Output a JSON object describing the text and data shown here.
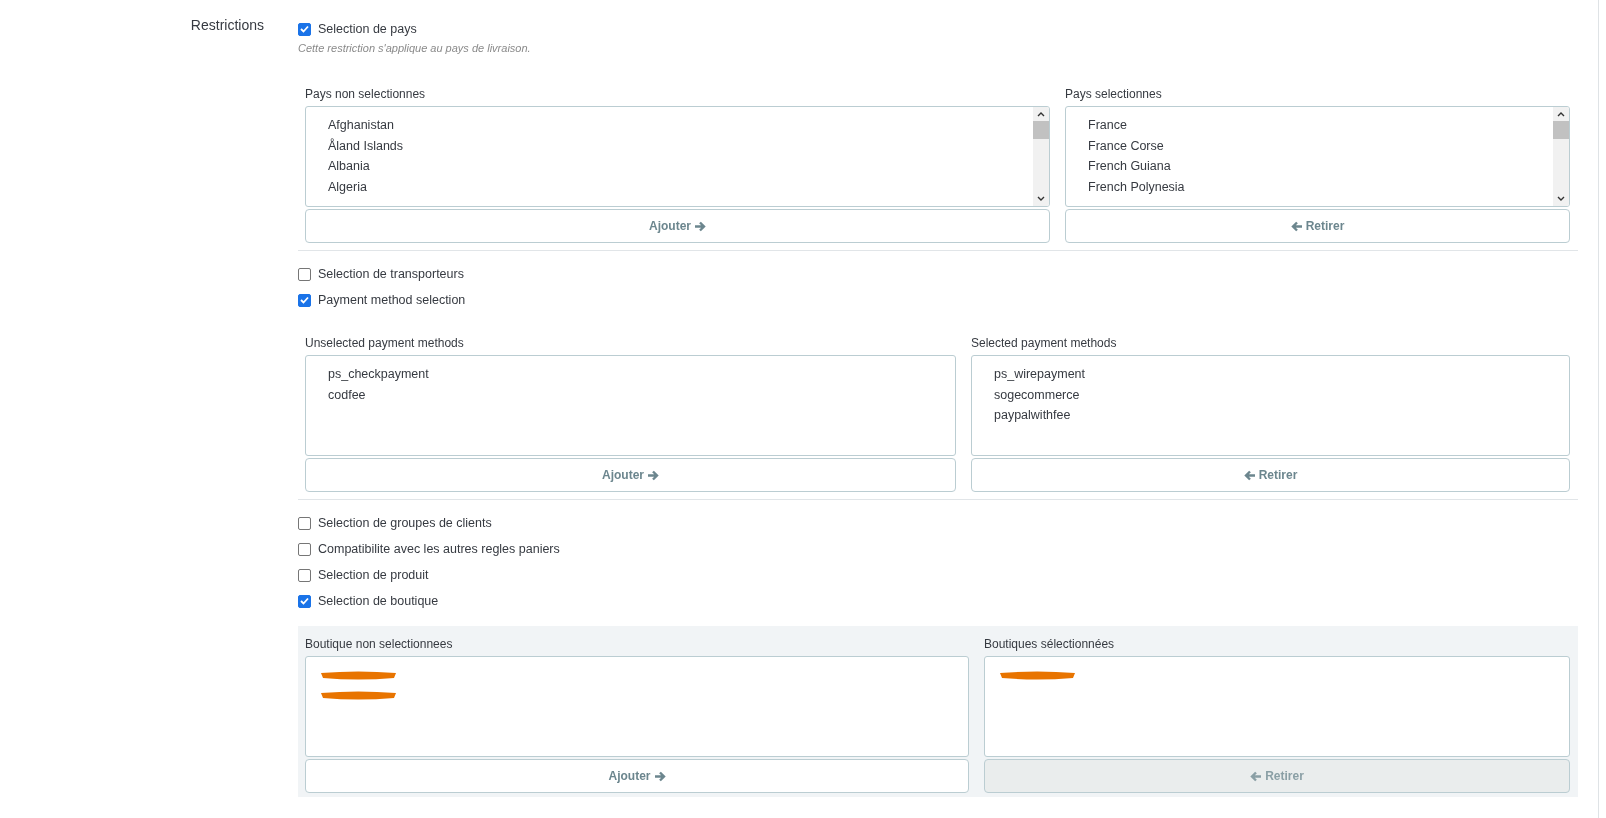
{
  "section_label": "Restrictions",
  "options": [
    {
      "label": "Selection de pays",
      "checked": true,
      "hint": "Cette restriction s'applique au pays de livraison.",
      "picker": {
        "shaded": false,
        "kind": "scrolling",
        "left": {
          "title": "Pays non selectionnes",
          "items": [
            {
              "kind": "text",
              "text": "Afghanistan"
            },
            {
              "kind": "text",
              "text": "Åland Islands"
            },
            {
              "kind": "text",
              "text": "Albania"
            },
            {
              "kind": "text",
              "text": "Algeria"
            }
          ],
          "button": {
            "label": "Ajouter",
            "disabled": false
          }
        },
        "right": {
          "title": "Pays selectionnes",
          "items": [
            {
              "kind": "text",
              "text": "France"
            },
            {
              "kind": "text",
              "text": "France Corse"
            },
            {
              "kind": "text",
              "text": "French Guiana"
            },
            {
              "kind": "text",
              "text": "French Polynesia"
            }
          ],
          "button": {
            "label": "Retirer",
            "disabled": false
          }
        }
      }
    },
    {
      "label": "Selection de transporteurs",
      "checked": false
    },
    {
      "label": "Payment method selection",
      "checked": true,
      "picker": {
        "shaded": false,
        "kind": "plain",
        "left": {
          "title": "Unselected payment methods",
          "items": [
            {
              "kind": "text",
              "text": "ps_checkpayment"
            },
            {
              "kind": "text",
              "text": "codfee"
            }
          ],
          "button": {
            "label": "Ajouter",
            "disabled": false
          }
        },
        "right": {
          "title": "Selected payment methods",
          "items": [
            {
              "kind": "text",
              "text": "ps_wirepayment"
            },
            {
              "kind": "text",
              "text": "sogecommerce"
            },
            {
              "kind": "text",
              "text": "paypalwithfee"
            }
          ],
          "button": {
            "label": "Retirer",
            "disabled": false
          }
        }
      }
    },
    {
      "label": "Selection de groupes de clients",
      "checked": false
    },
    {
      "label": "Compatibilite avec les autres regles paniers",
      "checked": false
    },
    {
      "label": "Selection de produit",
      "checked": false
    },
    {
      "label": "Selection de boutique",
      "checked": true,
      "picker": {
        "shaded": true,
        "kind": "plain",
        "left": {
          "title": "Boutique non selectionnees",
          "items": [
            {
              "kind": "redacted"
            },
            {
              "kind": "redacted"
            }
          ],
          "button": {
            "label": "Ajouter",
            "disabled": false
          }
        },
        "right": {
          "title": "Boutiques sélectionnées",
          "items": [
            {
              "kind": "redacted"
            }
          ],
          "button": {
            "label": "Retirer",
            "disabled": true
          }
        }
      }
    }
  ]
}
